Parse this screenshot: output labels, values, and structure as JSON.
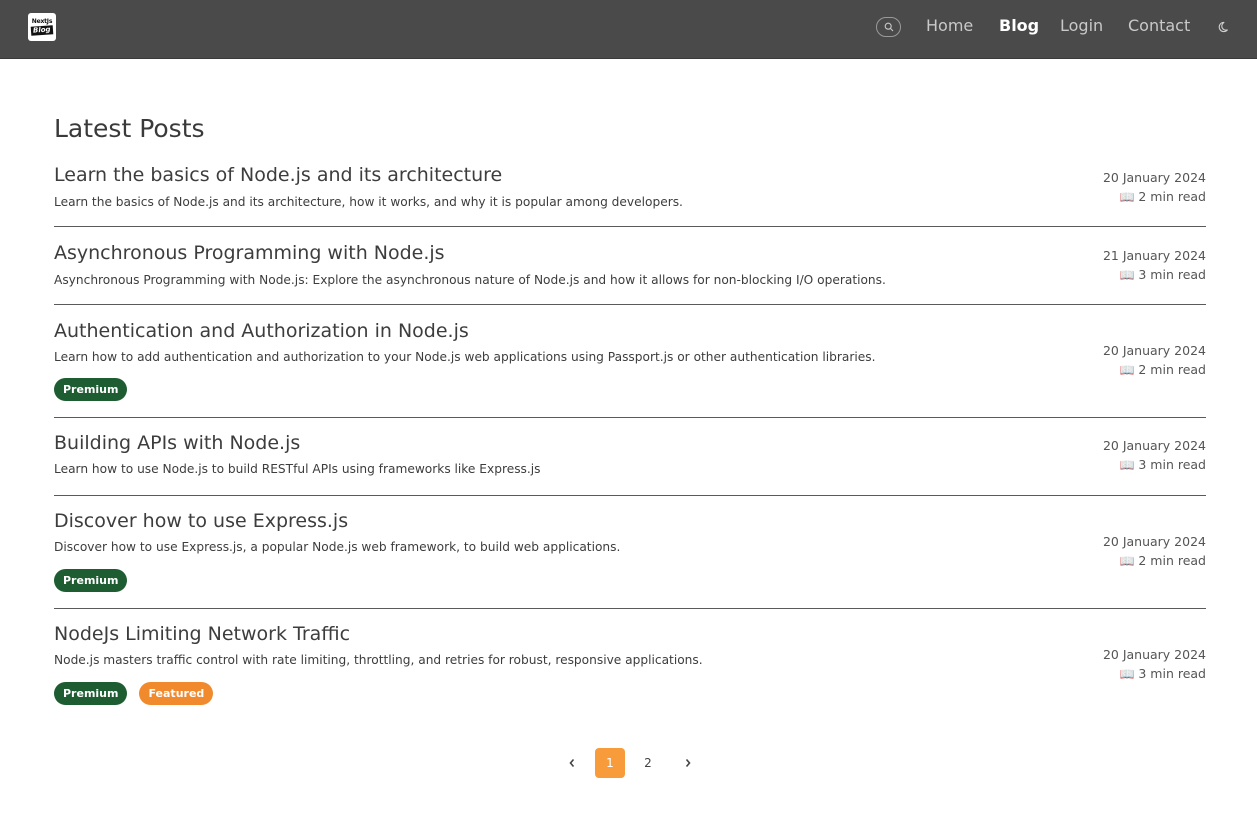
{
  "brand": {
    "logo_top": "NextJs",
    "logo_bottom": "Blog"
  },
  "nav": {
    "search_icon": "search-icon",
    "links": [
      {
        "label": "Home",
        "active": false
      },
      {
        "label": "Blog",
        "active": true
      },
      {
        "label": "Login",
        "active": false
      },
      {
        "label": "Contact",
        "active": false
      }
    ],
    "theme_icon": "moon-icon"
  },
  "page": {
    "title": "Latest Posts"
  },
  "posts": [
    {
      "title": "Learn the basics of Node.js and its architecture",
      "description": "Learn the basics of Node.js and its architecture, how it works, and why it is popular among developers.",
      "date": "20 January 2024",
      "read_time": "2 min read",
      "badges": []
    },
    {
      "title": "Asynchronous Programming with Node.js",
      "description": "Asynchronous Programming with Node.js: Explore the asynchronous nature of Node.js and how it allows for non-blocking I/O operations.",
      "date": "21 January 2024",
      "read_time": "3 min read",
      "badges": []
    },
    {
      "title": "Authentication and Authorization in Node.js",
      "description": "Learn how to add authentication and authorization to your Node.js web applications using Passport.js or other authentication libraries.",
      "date": "20 January 2024",
      "read_time": "2 min read",
      "badges": [
        "Premium"
      ]
    },
    {
      "title": "Building APIs with Node.js",
      "description": "Learn how to use Node.js to build RESTful APIs using frameworks like Express.js",
      "date": "20 January 2024",
      "read_time": "3 min read",
      "badges": []
    },
    {
      "title": "Discover how to use Express.js",
      "description": "Discover how to use Express.js, a popular Node.js web framework, to build web applications.",
      "date": "20 January 2024",
      "read_time": "2 min read",
      "badges": [
        "Premium"
      ]
    },
    {
      "title": "NodeJs Limiting Network Traffic",
      "description": "Node.js masters traffic control with rate limiting, throttling, and retries for robust, responsive applications.",
      "date": "20 January 2024",
      "read_time": "3 min read",
      "badges": [
        "Premium",
        "Featured"
      ]
    }
  ],
  "read_icon": "open-book-icon",
  "badge_colors": {
    "Premium": "#1e5c32",
    "Featured": "#f08a2c"
  },
  "pagination": {
    "prev_icon": "chevron-left-icon",
    "pages": [
      "1",
      "2"
    ],
    "current": "1",
    "next_icon": "chevron-right-icon",
    "accent": "#f79b3b"
  }
}
